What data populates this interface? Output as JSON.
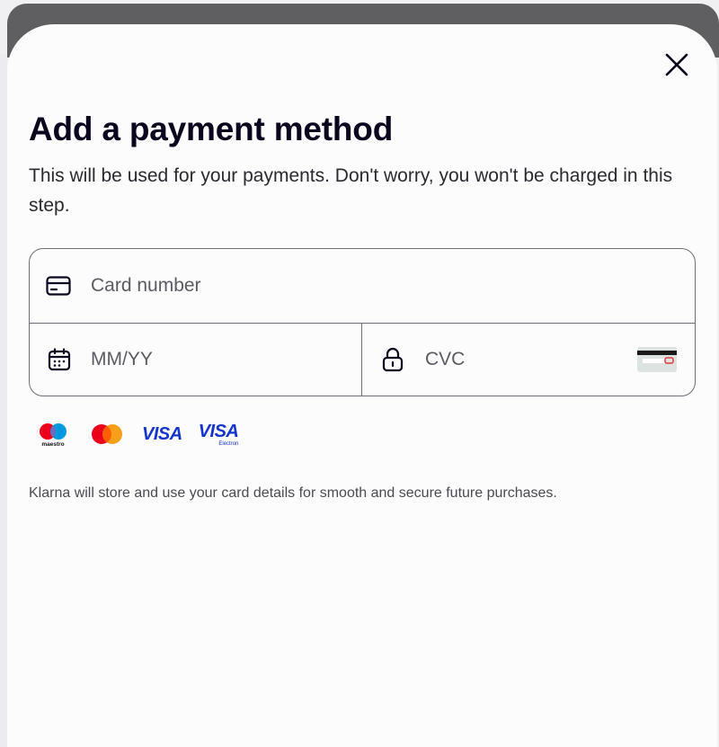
{
  "dialog": {
    "title": "Add a payment method",
    "subtitle": "This will be used for your payments. Don't worry, you won't be charged in this step.",
    "close_icon": "close-icon"
  },
  "card_form": {
    "card_number": {
      "value": "",
      "placeholder": "Card number",
      "icon": "credit-card-icon"
    },
    "expiry": {
      "value": "",
      "placeholder": "MM/YY",
      "icon": "calendar-icon"
    },
    "cvc": {
      "value": "",
      "placeholder": "CVC",
      "icon": "lock-icon",
      "hint_icon": "card-back-cvc-icon"
    }
  },
  "brands": [
    {
      "name": "maestro",
      "caption": "maestro"
    },
    {
      "name": "mastercard"
    },
    {
      "name": "visa",
      "label": "VISA"
    },
    {
      "name": "visa-electron",
      "label": "VISA",
      "caption": "Electron"
    }
  ],
  "disclaimer": "Klarna will store and use your card details for smooth and secure future purchases.",
  "colors": {
    "text_primary": "#0b051d",
    "border": "#6e6e76",
    "visa_blue": "#1434cb",
    "mastercard_red": "#eb001b",
    "mastercard_orange": "#f79e1b",
    "maestro_blue": "#0099df"
  }
}
